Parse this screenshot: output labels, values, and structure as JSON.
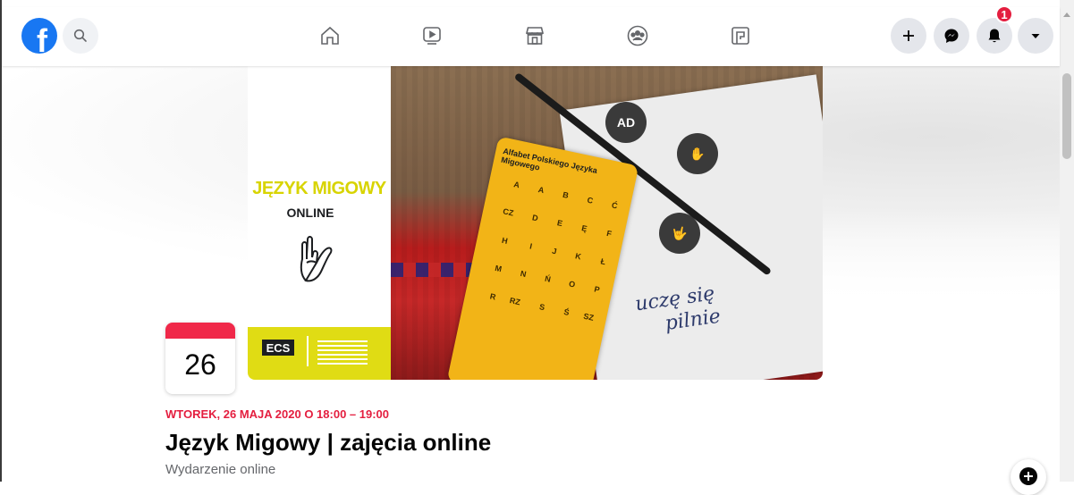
{
  "topbar": {
    "logo_letter": "f",
    "nav_icons": [
      "home-icon",
      "watch-icon",
      "marketplace-icon",
      "groups-icon",
      "gaming-icon"
    ],
    "notification_count": "1",
    "accent": "#1877f2",
    "badge_color": "#e41e3f"
  },
  "cover": {
    "title": "JĘZYK MIGOWY",
    "subtitle": "ONLINE",
    "org_logo": "ECS",
    "card_heading": "Alfabet Polskiego Języka Migowego",
    "card_letters": [
      "A",
      "A",
      "B",
      "C",
      "Ć",
      "CZ",
      "D",
      "E",
      "Ę",
      "F",
      "H",
      "I",
      "J",
      "K",
      "Ł",
      "M",
      "N",
      "Ń",
      "O",
      "P",
      "R",
      "RZ",
      "S",
      "Ś",
      "SZ"
    ],
    "handwriting_line1": "uczę się",
    "handwriting_line2": "pilnie",
    "badge_ad": "AD"
  },
  "event": {
    "day": "26",
    "date_line": "WTOREK, 26 MAJA 2020 O 18:00 – 19:00",
    "title": "Język Migowy | zajęcia online",
    "subtitle": "Wydarzenie online",
    "date_color": "#e41e3f"
  }
}
